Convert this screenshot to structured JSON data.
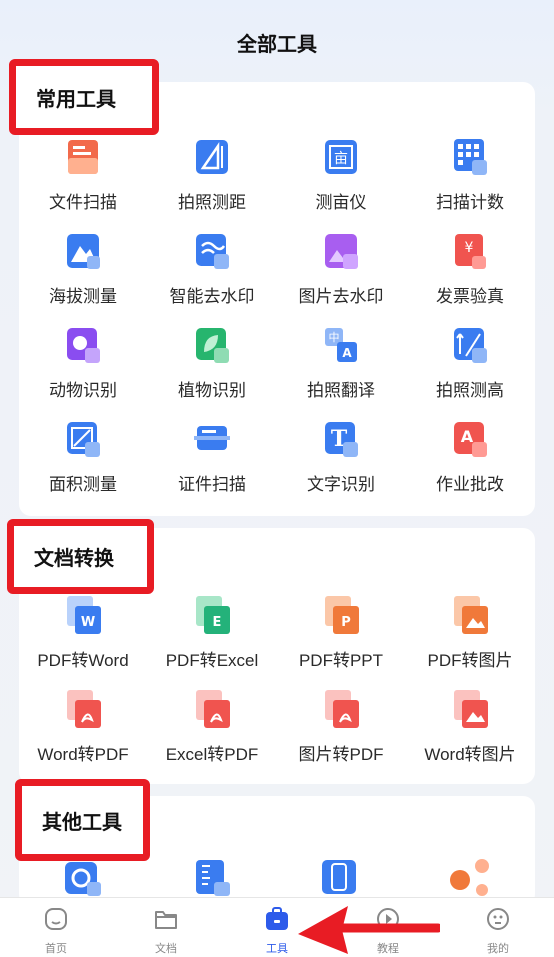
{
  "header": {
    "title": "全部工具"
  },
  "sections": [
    {
      "title": "常用工具"
    },
    {
      "title": "文档转换"
    },
    {
      "title": "其他工具"
    }
  ],
  "common_tools": [
    {
      "label": "文件扫描",
      "icon": "file-scan-icon"
    },
    {
      "label": "拍照测距",
      "icon": "ruler-icon"
    },
    {
      "label": "测亩仪",
      "icon": "field-measure-icon"
    },
    {
      "label": "扫描计数",
      "icon": "counter-icon"
    },
    {
      "label": "海拔测量",
      "icon": "mountain-icon"
    },
    {
      "label": "智能去水印",
      "icon": "watermark-remove-icon"
    },
    {
      "label": "图片去水印",
      "icon": "image-watermark-icon"
    },
    {
      "label": "发票验真",
      "icon": "invoice-icon"
    },
    {
      "label": "动物识别",
      "icon": "dog-icon"
    },
    {
      "label": "植物识别",
      "icon": "leaf-icon"
    },
    {
      "label": "拍照翻译",
      "icon": "translate-icon"
    },
    {
      "label": "拍照测高",
      "icon": "height-measure-icon"
    },
    {
      "label": "面积测量",
      "icon": "area-icon"
    },
    {
      "label": "证件扫描",
      "icon": "id-card-icon"
    },
    {
      "label": "文字识别",
      "icon": "text-ocr-icon"
    },
    {
      "label": "作业批改",
      "icon": "homework-icon"
    }
  ],
  "doc_tools": [
    {
      "label": "PDF转Word",
      "icon": "pdf-to-word-icon",
      "badge": "W"
    },
    {
      "label": "PDF转Excel",
      "icon": "pdf-to-excel-icon",
      "badge": "E"
    },
    {
      "label": "PDF转PPT",
      "icon": "pdf-to-ppt-icon",
      "badge": "P"
    },
    {
      "label": "PDF转图片",
      "icon": "pdf-to-image-icon",
      "badge": ""
    },
    {
      "label": "Word转PDF",
      "icon": "word-to-pdf-icon",
      "badge": ""
    },
    {
      "label": "Excel转PDF",
      "icon": "excel-to-pdf-icon",
      "badge": ""
    },
    {
      "label": "图片转PDF",
      "icon": "image-to-pdf-icon",
      "badge": ""
    },
    {
      "label": "Word转图片",
      "icon": "word-to-image-icon",
      "badge": ""
    }
  ],
  "tabbar": [
    {
      "label": "首页",
      "icon": "home-icon"
    },
    {
      "label": "文档",
      "icon": "folder-icon"
    },
    {
      "label": "工具",
      "icon": "toolbox-icon",
      "active": true
    },
    {
      "label": "教程",
      "icon": "play-icon"
    },
    {
      "label": "我的",
      "icon": "profile-icon"
    }
  ],
  "colors": {
    "accent": "#2d5bea",
    "highlight_border": "#e81c24",
    "word_blue": "#3a7cf0",
    "excel_green": "#24b27a",
    "ppt_orange": "#f0793a",
    "pdf_red": "#f0544f"
  }
}
